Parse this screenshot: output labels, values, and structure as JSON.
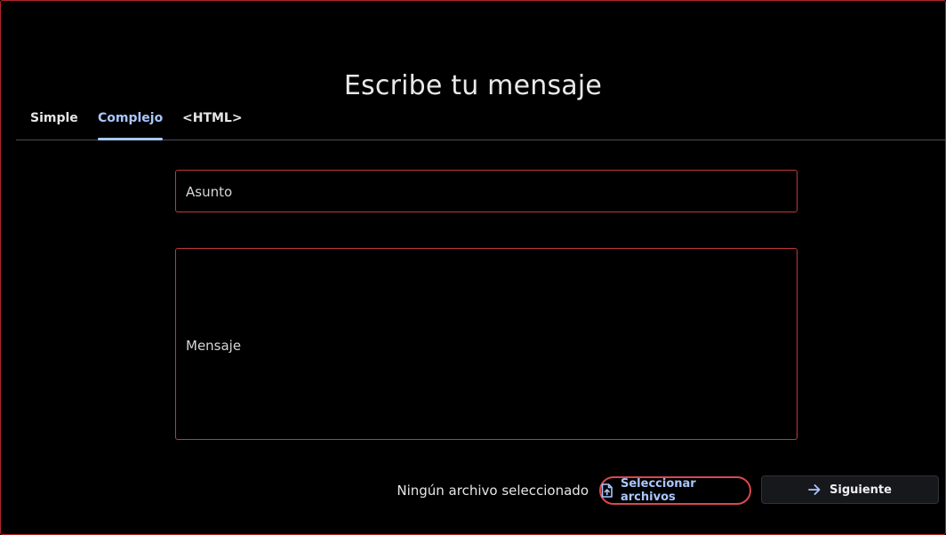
{
  "page": {
    "title": "Escribe tu mensaje"
  },
  "tabs": [
    {
      "label": "Simple",
      "active": false
    },
    {
      "label": "Complejo",
      "active": true
    },
    {
      "label": "<HTML>",
      "active": false
    }
  ],
  "form": {
    "subject_label": "Asunto",
    "message_label": "Mensaje",
    "file_status": "Ningún archivo seleccionado",
    "select_files_label": "Seleccionar archivos",
    "next_label": "Siguiente"
  },
  "icons": {
    "file_upload": "file-upload-icon",
    "arrow_right": "arrow-right-icon"
  },
  "colors": {
    "accent": "#a9c7ff",
    "error_border": "#c0383c",
    "background": "#000000",
    "button_dark": "#16181c"
  }
}
